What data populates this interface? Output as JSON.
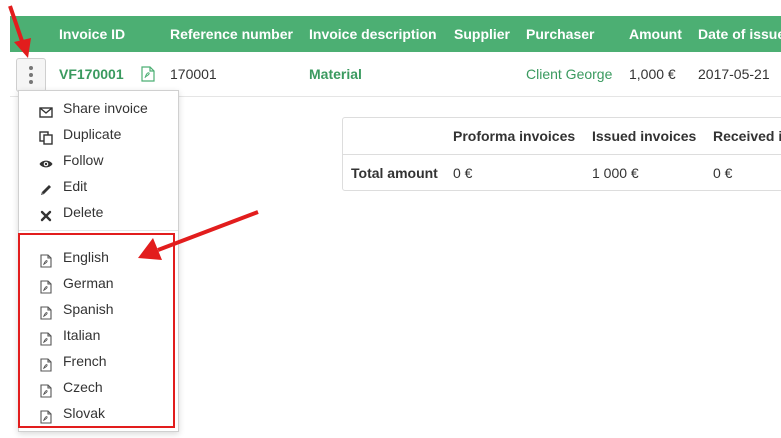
{
  "table": {
    "headers": [
      "Invoice ID",
      "Reference number",
      "Invoice description",
      "Supplier",
      "Purchaser",
      "Amount",
      "Date of issue"
    ],
    "row": {
      "invoice_id": "VF170001",
      "reference": "170001",
      "description": "Material",
      "supplier": "",
      "purchaser": "Client George",
      "amount": "1,000 €",
      "date": "2017-05-21"
    }
  },
  "menu": {
    "actions": [
      {
        "icon": "envelope-icon",
        "label": "Share invoice"
      },
      {
        "icon": "duplicate-icon",
        "label": "Duplicate"
      },
      {
        "icon": "eye-icon",
        "label": "Follow"
      },
      {
        "icon": "pencil-icon",
        "label": "Edit"
      },
      {
        "icon": "close-icon",
        "label": "Delete"
      }
    ],
    "pdf_languages": [
      {
        "icon": "pdf-icon",
        "label": "English"
      },
      {
        "icon": "pdf-icon",
        "label": "German"
      },
      {
        "icon": "pdf-icon",
        "label": "Spanish"
      },
      {
        "icon": "pdf-icon",
        "label": "Italian"
      },
      {
        "icon": "pdf-icon",
        "label": "French"
      },
      {
        "icon": "pdf-icon",
        "label": "Czech"
      },
      {
        "icon": "pdf-icon",
        "label": "Slovak"
      }
    ]
  },
  "summary": {
    "headers": [
      "Proforma invoices",
      "Issued invoices",
      "Received i"
    ],
    "row_label": "Total amount",
    "values": [
      "0 €",
      "1 000 €",
      "0 €"
    ]
  },
  "colors": {
    "header_bg": "#4caf73",
    "link": "#3a9a5f",
    "annotation": "#e21d1d"
  }
}
